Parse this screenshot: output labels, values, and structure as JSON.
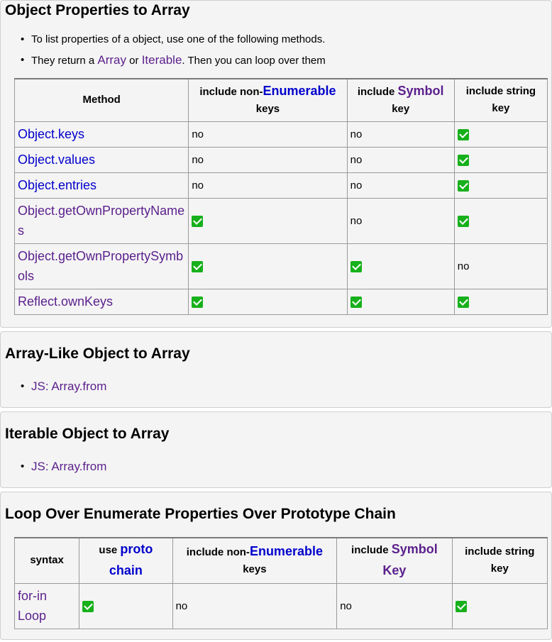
{
  "s1": {
    "title": "Object Properties to Array",
    "bullet1": "To list properties of a object, use one of the following methods.",
    "bullet2_pre": "They return a ",
    "bullet2_array": "Array",
    "bullet2_or": " or ",
    "bullet2_iterable": "Iterable",
    "bullet2_post": ". Then you can loop over them",
    "headers": {
      "method": "Method",
      "nonenum_pre": "include non-",
      "nonenum_kw": "Enumerable",
      "nonenum_post": "keys",
      "symbol_pre": "include ",
      "symbol_kw": "Symbol",
      "symbol_post": "key",
      "string": "include string key"
    },
    "rows": [
      {
        "method": "Object.keys",
        "nonenum": "no",
        "symbol": "no",
        "string": "check"
      },
      {
        "method": "Object.values",
        "nonenum": "no",
        "symbol": "no",
        "string": "check"
      },
      {
        "method": "Object.entries",
        "nonenum": "no",
        "symbol": "no",
        "string": "check"
      },
      {
        "method": "Object.getOwnPropertyNames",
        "nonenum": "check",
        "symbol": "no",
        "string": "check"
      },
      {
        "method": "Object.getOwnPropertySymbols",
        "nonenum": "check",
        "symbol": "check",
        "string": "no"
      },
      {
        "method": "Reflect.ownKeys",
        "nonenum": "check",
        "symbol": "check",
        "string": "check"
      }
    ]
  },
  "s2": {
    "title": "Array-Like Object to Array",
    "link": "JS: Array.from"
  },
  "s3": {
    "title": "Iterable Object to Array",
    "link": "JS: Array.from"
  },
  "s4": {
    "title": "Loop Over Enumerate Properties Over Prototype Chain",
    "headers": {
      "syntax": "syntax",
      "proto_pre": "use ",
      "proto_kw": "proto chain",
      "nonenum_pre": "include non-",
      "nonenum_kw": "Enumerable",
      "nonenum_post": "keys",
      "symbol_pre": "include ",
      "symbol_kw": "Symbol Key",
      "string": "include string key"
    },
    "row": {
      "syntax": "for-in Loop",
      "proto": "check",
      "nonenum": "no",
      "symbol": "no",
      "string": "check"
    }
  },
  "colors": {
    "link_blue": "#0000cc",
    "link_purple": "#5a1f8c",
    "check_green": "#17b01b"
  }
}
